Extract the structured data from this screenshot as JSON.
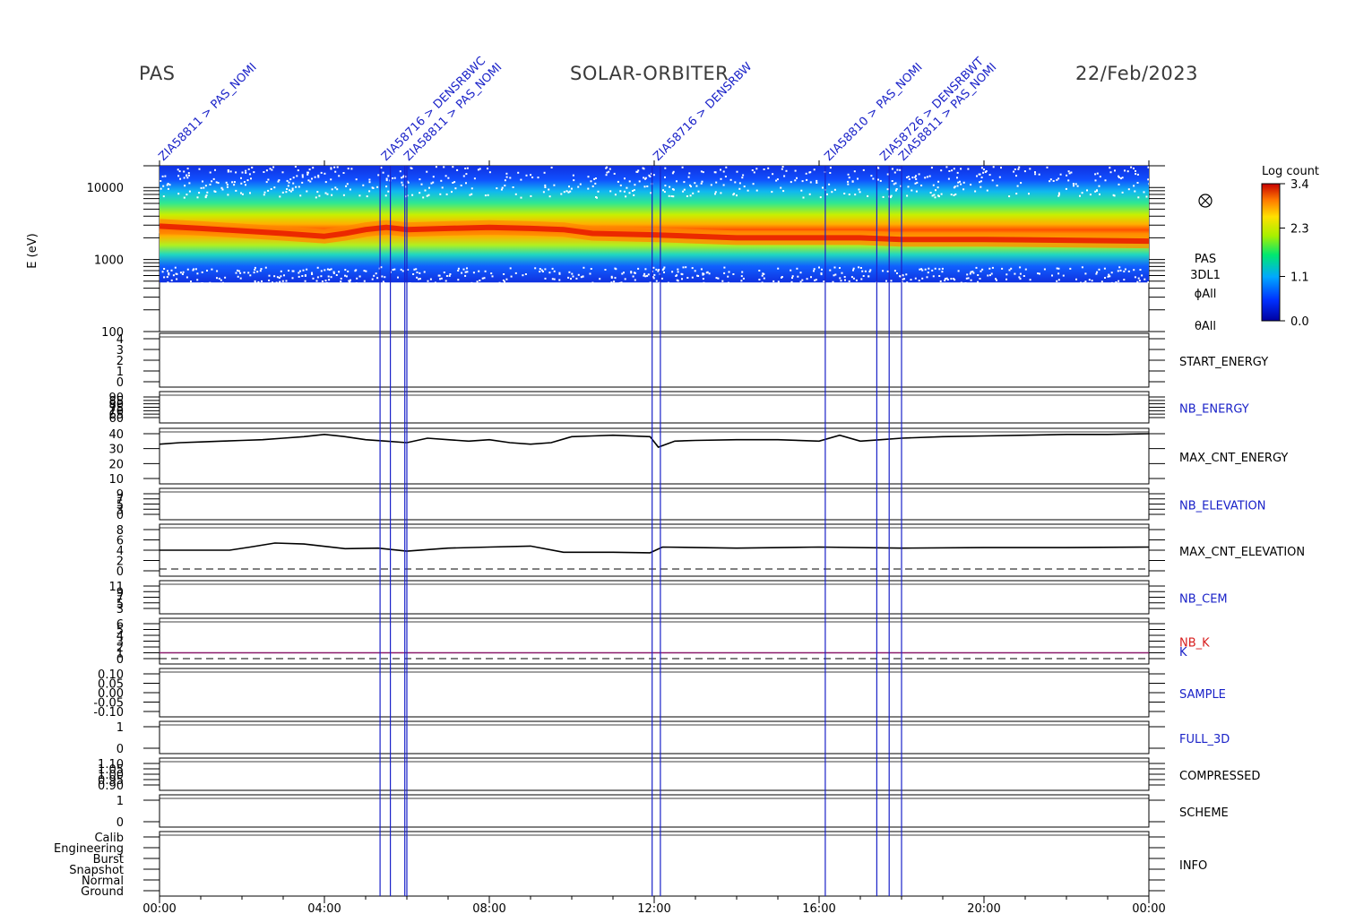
{
  "header": {
    "left": "PAS",
    "center": "SOLAR-ORBITER",
    "right": "22/Feb/2023"
  },
  "colors": {
    "axis": "#000000",
    "blue_label": "#1a22c8",
    "red_label": "#d81e1e",
    "event_line": "#1a22c8",
    "k_line": "#8b1a6b"
  },
  "chart_data": {
    "type": "spectrogram",
    "x_ticks": [
      "00:00",
      "04:00",
      "08:00",
      "12:00",
      "16:00",
      "20:00",
      "00:00"
    ],
    "x_range_hours": [
      0,
      24
    ],
    "event_markers": {
      "hours": [
        5.35,
        5.6,
        5.95,
        6.0,
        11.95,
        12.15,
        16.15,
        17.4,
        17.7,
        18.0
      ],
      "labels": [
        "ZIA58811 > PAS_NOMI",
        "ZIA58716 > DENSRBWC",
        "ZIA58811 > PAS_NOMI",
        "ZIA58716 > DENSRBW",
        "ZIA58810 > PAS_NOMI",
        "ZIA58726 > DENSRBWT",
        "ZIA58811 > PAS_NOMI"
      ]
    },
    "spectrogram": {
      "ylabel": "E (eV)",
      "y_ticks": [
        "10000",
        "1000",
        "100"
      ],
      "y_scale": "log",
      "ylim": [
        100,
        20000
      ],
      "colorbar": {
        "title": "Log count",
        "ticks": [
          "3.4",
          "2.3",
          "1.1",
          "0.0"
        ],
        "range": [
          0.0,
          3.4
        ]
      },
      "peak_energy_trace": {
        "hours": [
          0,
          1,
          2,
          3,
          4,
          4.5,
          5,
          5.5,
          6,
          7,
          8,
          9,
          9.8,
          10.5,
          12,
          13,
          14,
          15,
          16,
          17,
          18,
          20,
          22,
          24
        ],
        "energy_ev": [
          2900,
          2700,
          2500,
          2300,
          2100,
          2300,
          2600,
          2800,
          2600,
          2700,
          2800,
          2700,
          2600,
          2300,
          2200,
          2100,
          2000,
          2000,
          2000,
          2000,
          1900,
          1900,
          1850,
          1800
        ]
      },
      "right_labels": [
        "PAS",
        "3DL1",
        "ϕAll",
        "θAll"
      ]
    },
    "panels": [
      {
        "name": "START_ENERGY",
        "label_color": "black",
        "y_ticks": [
          "4",
          "3",
          "2",
          "1",
          "0"
        ]
      },
      {
        "name": "NB_ENERGY",
        "label_color": "blue",
        "y_ticks": [
          "90",
          "85",
          "80",
          "75",
          "70",
          "65",
          "60"
        ]
      },
      {
        "name": "MAX_CNT_ENERGY",
        "label_color": "black",
        "y_ticks": [
          "40",
          "30",
          "20",
          "10"
        ],
        "series": {
          "hours": [
            0,
            0.5,
            1,
            1.5,
            2,
            2.5,
            3,
            3.5,
            4,
            4.5,
            5,
            5.5,
            6,
            6.5,
            7,
            7.5,
            8,
            8.5,
            9,
            9.5,
            10,
            10.5,
            11,
            11.9,
            12.1,
            12.5,
            13,
            14,
            15,
            16,
            16.5,
            17,
            17.5,
            18,
            19,
            20,
            21,
            22,
            23,
            24
          ],
          "values": [
            33,
            34,
            34.5,
            35,
            35.5,
            36,
            37,
            38,
            39.5,
            38,
            36,
            35,
            34,
            37,
            36,
            35,
            36,
            34,
            33,
            34,
            38,
            38.5,
            39,
            38,
            31,
            35,
            35.5,
            36,
            36,
            35,
            39,
            35,
            36,
            37,
            38,
            38.5,
            39,
            39.5,
            39.5,
            40
          ]
        }
      },
      {
        "name": "NB_ELEVATION",
        "label_color": "blue",
        "y_ticks": [
          "9",
          "7",
          "5",
          "3",
          "0"
        ]
      },
      {
        "name": "MAX_CNT_ELEVATION",
        "label_color": "black",
        "y_ticks": [
          "8",
          "6",
          "4",
          "2",
          "0"
        ],
        "series": {
          "hours": [
            0,
            1.7,
            2.2,
            2.8,
            3.5,
            4.5,
            5.3,
            6,
            7,
            8,
            9,
            9.8,
            11,
            11.9,
            12.2,
            14,
            16,
            18,
            20,
            22,
            24
          ],
          "values": [
            4,
            4,
            4.6,
            5.4,
            5.2,
            4.3,
            4.4,
            3.8,
            4.4,
            4.6,
            4.8,
            3.6,
            3.6,
            3.5,
            4.6,
            4.4,
            4.6,
            4.4,
            4.5,
            4.5,
            4.6
          ]
        }
      },
      {
        "name": "NB_CEM",
        "label_color": "blue",
        "y_ticks": [
          "11",
          "9",
          "7",
          "5",
          "3"
        ]
      },
      {
        "name": "NB_K",
        "label_color": "red",
        "y_ticks": [
          "6",
          "5",
          "4",
          "3",
          "2",
          "1",
          "0"
        ],
        "constant_value": 1,
        "extra_label": "K",
        "extra_label_color": "blue"
      },
      {
        "name": "SAMPLE",
        "label_color": "blue",
        "y_ticks": [
          "0.10",
          "0.05",
          "0.00",
          "-0.05",
          "-0.10"
        ]
      },
      {
        "name": "FULL_3D",
        "label_color": "blue",
        "y_ticks": [
          "1",
          "0"
        ]
      },
      {
        "name": "COMPRESSED",
        "label_color": "black",
        "y_ticks": [
          "1.10",
          "1.05",
          "1.00",
          "0.95",
          "0.90"
        ]
      },
      {
        "name": "SCHEME",
        "label_color": "black",
        "y_ticks": [
          "1",
          "0"
        ]
      },
      {
        "name": "INFO",
        "label_color": "black",
        "y_ticks": [
          "Calib",
          "Engineering",
          "Burst",
          "Snapshot",
          "Normal",
          "Ground"
        ]
      }
    ]
  }
}
